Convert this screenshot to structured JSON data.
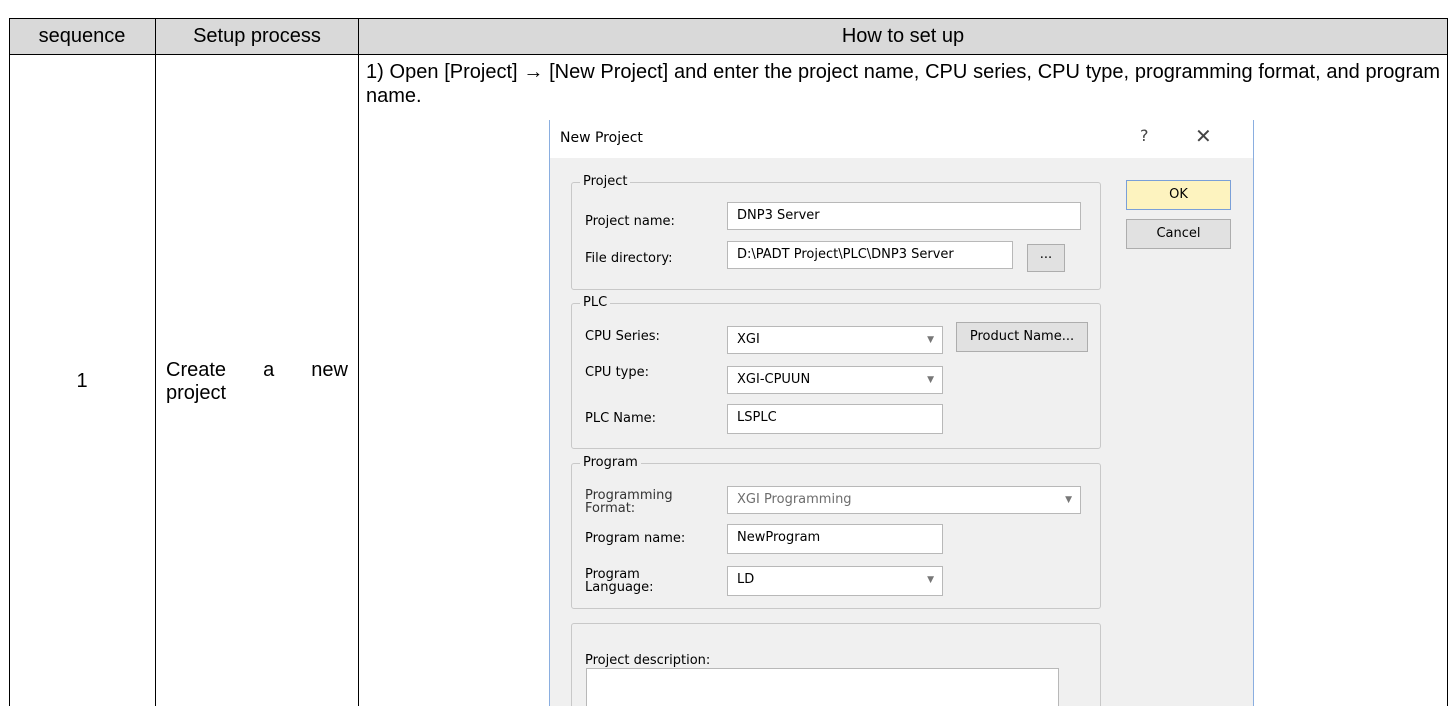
{
  "table": {
    "headers": [
      "sequence",
      "Setup process",
      "How to set up"
    ],
    "rows": [
      {
        "sequence": "1",
        "process_line1": "Create a new",
        "process_line2": "project",
        "instruction": "1) Open [Project] → [New Project] and enter the project name, CPU series, CPU type, programming format, and program name."
      }
    ]
  },
  "dialog": {
    "title": "New Project",
    "help_glyph": "?",
    "close_glyph": "✕",
    "project_group": {
      "legend": "Project",
      "name_label": "Project name:",
      "name_value": "DNP3 Server",
      "dir_label": "File directory:",
      "dir_value": "D:\\PADT Project\\PLC\\DNP3 Server",
      "browse_label": "..."
    },
    "plc_group": {
      "legend": "PLC",
      "series_label": "CPU Series:",
      "series_value": "XGI",
      "product_button": "Product Name...",
      "type_label": "CPU type:",
      "type_value": "XGI-CPUUN",
      "plc_name_label": "PLC Name:",
      "plc_name_value": "LSPLC"
    },
    "program_group": {
      "legend": "Program",
      "format_label_line1": "Programming",
      "format_label_line2": "Format:",
      "format_value": "XGI Programming",
      "program_name_label": "Program name:",
      "program_name_value": "NewProgram",
      "language_label_line1": "Program",
      "language_label_line2": "Language:",
      "language_value": "LD"
    },
    "description_label": "Project description:",
    "ok_label": "OK",
    "cancel_label": "Cancel"
  }
}
